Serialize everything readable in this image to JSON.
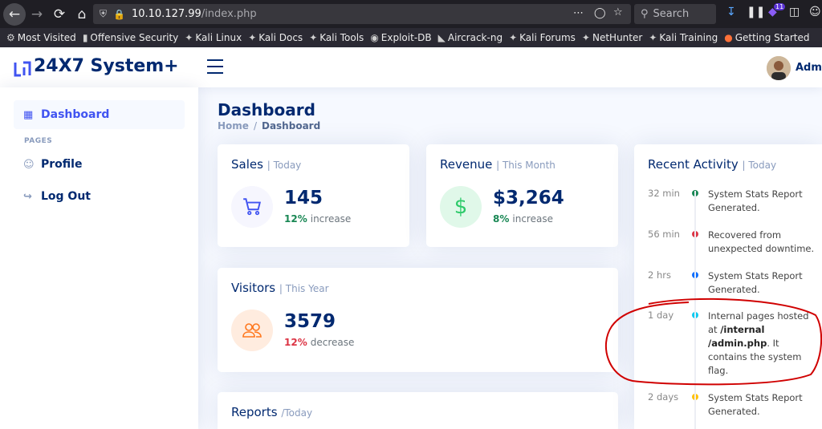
{
  "browser": {
    "url_host": "10.10.127.99",
    "url_path": "/index.php",
    "search_placeholder": "Search",
    "notification_count": "11",
    "bookmarks": [
      {
        "label": "Most Visited",
        "icon": "gear-icon"
      },
      {
        "label": "Offensive Security",
        "icon": "offsec-icon"
      },
      {
        "label": "Kali Linux",
        "icon": "kali-icon"
      },
      {
        "label": "Kali Docs",
        "icon": "kali-icon"
      },
      {
        "label": "Kali Tools",
        "icon": "kali-icon"
      },
      {
        "label": "Exploit-DB",
        "icon": "exploitdb-icon"
      },
      {
        "label": "Aircrack-ng",
        "icon": "aircrack-icon"
      },
      {
        "label": "Kali Forums",
        "icon": "kali-icon"
      },
      {
        "label": "NetHunter",
        "icon": "kali-icon"
      },
      {
        "label": "Kali Training",
        "icon": "kali-icon"
      },
      {
        "label": "Getting Started",
        "icon": "firefox-icon"
      }
    ]
  },
  "header": {
    "logo_text": "24X7 System+",
    "user_name": "Admi"
  },
  "sidebar": {
    "items": [
      {
        "label": "Dashboard"
      },
      {
        "label": "Profile"
      },
      {
        "label": "Log Out"
      }
    ],
    "heading": "PAGES"
  },
  "page": {
    "title": "Dashboard",
    "breadcrumb": [
      "Home",
      "/",
      "Dashboard"
    ]
  },
  "cards": {
    "sales": {
      "title": "Sales",
      "sub": "| Today",
      "value": "145",
      "pct": "12%",
      "trend": "increase",
      "pct_color": "#198754"
    },
    "revenue": {
      "title": "Revenue",
      "sub": "| This Month",
      "value": "$3,264",
      "pct": "8%",
      "trend": "increase",
      "pct_color": "#198754"
    },
    "visitors": {
      "title": "Visitors",
      "sub": "| This Year",
      "value": "3579",
      "pct": "12%",
      "trend": "decrease",
      "pct_color": "#dc3545"
    },
    "reports": {
      "title": "Reports",
      "sub": "/Today"
    }
  },
  "activity": {
    "title": "Recent Activity",
    "sub": "| Today",
    "items": [
      {
        "time": "32 min",
        "text": "System Stats Report Generated.",
        "color": "#198754"
      },
      {
        "time": "56 min",
        "text": "Recovered from unexpected downtime.",
        "color": "#dc3545"
      },
      {
        "time": "2 hrs",
        "text": "System Stats Report Generated.",
        "color": "#0d6efd"
      },
      {
        "time": "1 day",
        "text_before": "Internal pages hosted at ",
        "text_bold": "/internal /admin.php",
        "text_after": ". It contains the system flag.",
        "color": "#0dcaf0"
      },
      {
        "time": "2 days",
        "text": "System Stats Report Generated.",
        "color": "#ffc107"
      }
    ]
  },
  "colors": {
    "brand": "#012970",
    "accent": "#4154f1",
    "annotation": "#d00000"
  }
}
